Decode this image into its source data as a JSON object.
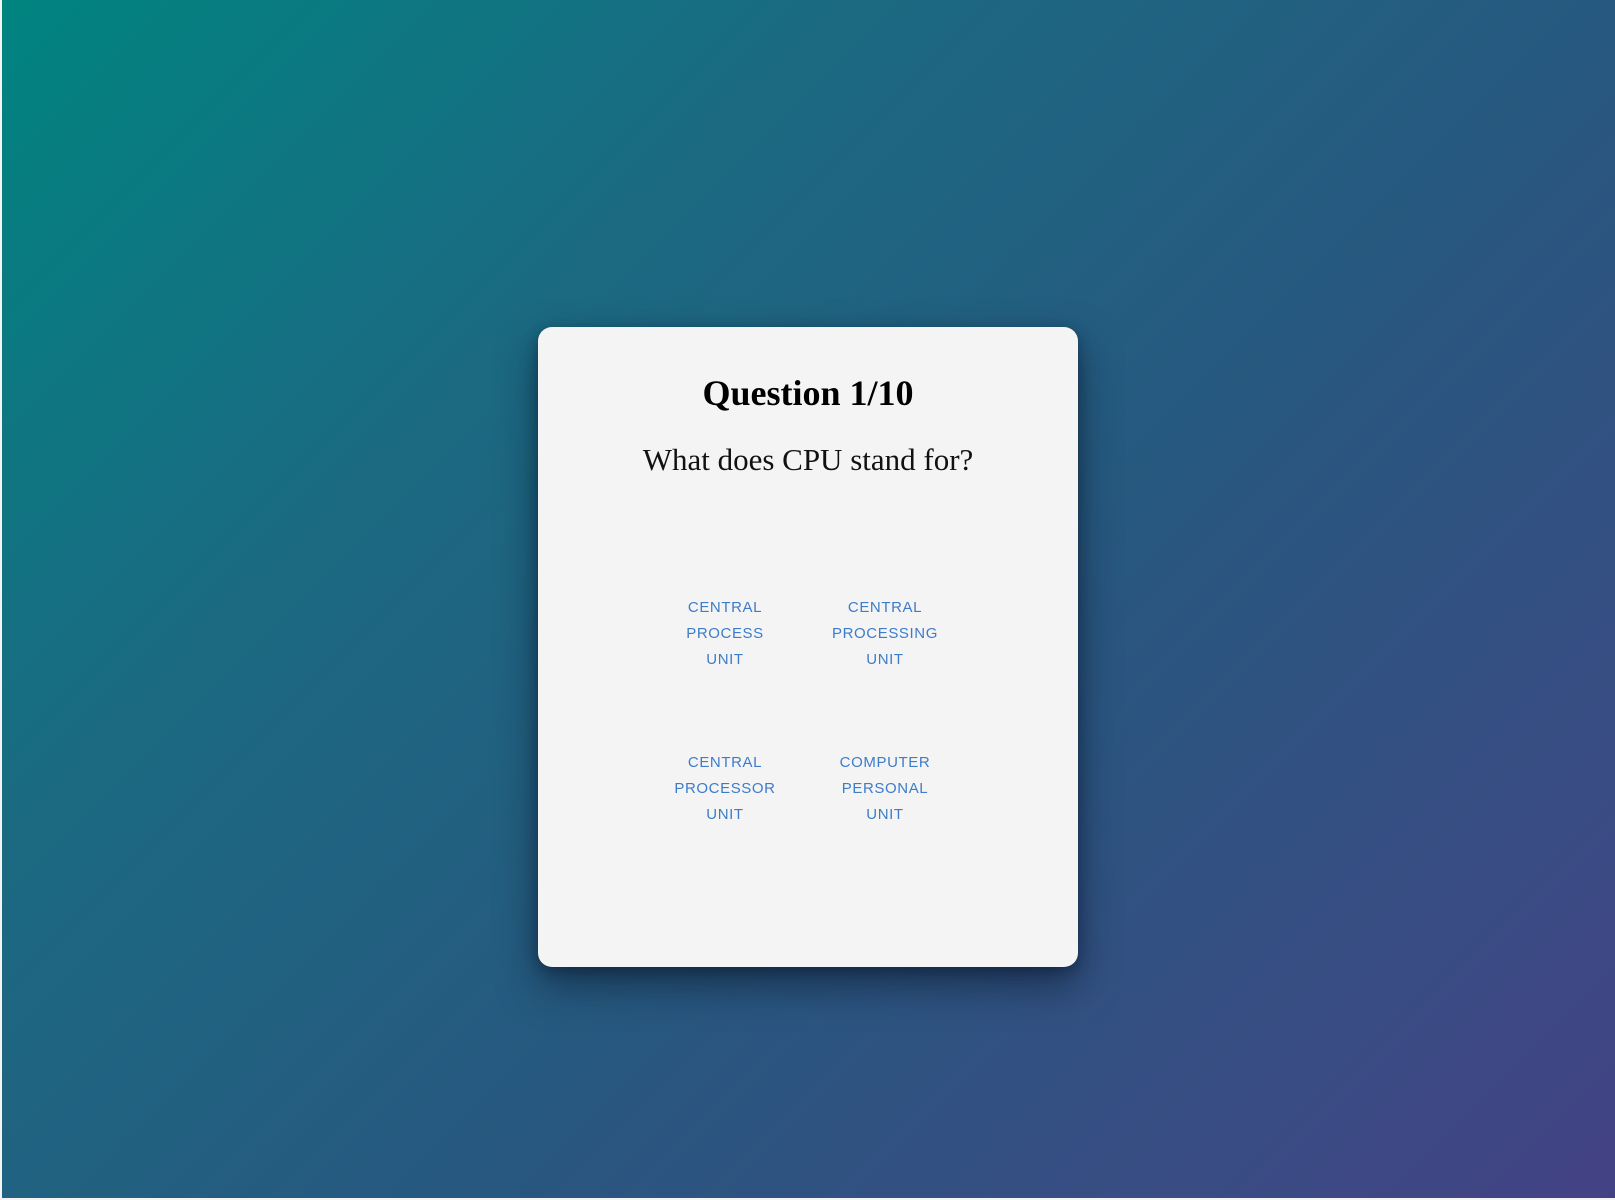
{
  "quiz": {
    "counter": "Question 1/10",
    "question": "What does CPU stand for?",
    "answers": [
      {
        "label": "CENTRAL PROCESS UNIT"
      },
      {
        "label": "CENTRAL PROCESSING UNIT"
      },
      {
        "label": "CENTRAL PROCESSOR UNIT"
      },
      {
        "label": "COMPUTER PERSONAL UNIT"
      }
    ]
  },
  "colors": {
    "background_start": "#008480",
    "background_end": "#434184",
    "card": "#f4f4f4",
    "answer_text": "#3d7cc9"
  }
}
